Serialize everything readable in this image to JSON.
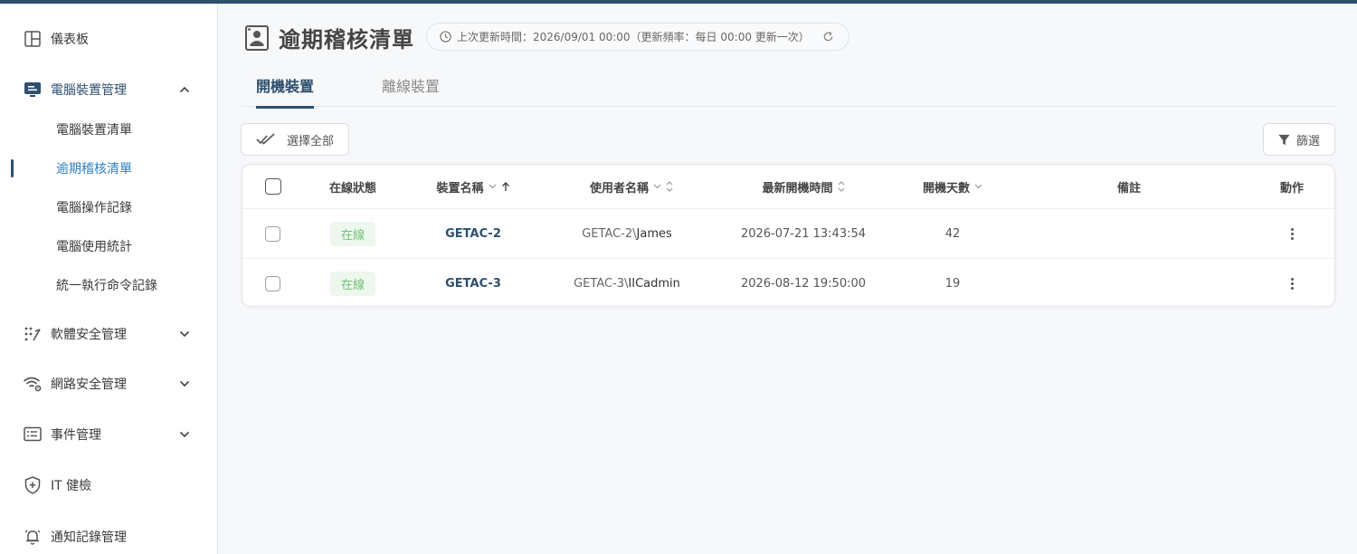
{
  "sidebar": {
    "items": [
      {
        "label": "儀表板"
      },
      {
        "label": "電腦裝置管理"
      },
      {
        "label": "軟體安全管理"
      },
      {
        "label": "網路安全管理"
      },
      {
        "label": "事件管理"
      },
      {
        "label": "IT 健檢"
      },
      {
        "label": "通知記錄管理"
      }
    ],
    "sub_items": [
      {
        "label": "電腦裝置清單"
      },
      {
        "label": "逾期稽核清單"
      },
      {
        "label": "電腦操作記錄"
      },
      {
        "label": "電腦使用統計"
      },
      {
        "label": "統一執行命令記錄"
      }
    ]
  },
  "header": {
    "title": "逾期稽核清單",
    "update_info": "上次更新時間：2026/09/01 00:00（更新頻率：每日 00:00 更新一次）"
  },
  "tabs": [
    {
      "label": "開機裝置"
    },
    {
      "label": "離線裝置"
    }
  ],
  "toolbar": {
    "select_all_label": "選擇全部",
    "filter_label": "篩選"
  },
  "table": {
    "columns": {
      "status": "在線狀態",
      "device": "裝置名稱",
      "user": "使用者名稱",
      "last_boot": "最新開機時間",
      "days": "開機天數",
      "note": "備註",
      "action": "動作"
    },
    "rows": [
      {
        "status": "在線",
        "device": "GETAC-2",
        "user_domain": "GETAC-2\\",
        "user_name": "James",
        "last_boot": "2026-07-21 13:43:54",
        "days": "42",
        "note": ""
      },
      {
        "status": "在線",
        "device": "GETAC-3",
        "user_domain": "GETAC-3\\",
        "user_name": "IICadmin",
        "last_boot": "2026-08-12 19:50:00",
        "days": "19",
        "note": ""
      }
    ]
  },
  "colors": {
    "brand": "#2e4f6e",
    "active_link": "#2f7fc1",
    "online": "#6fbf73"
  }
}
